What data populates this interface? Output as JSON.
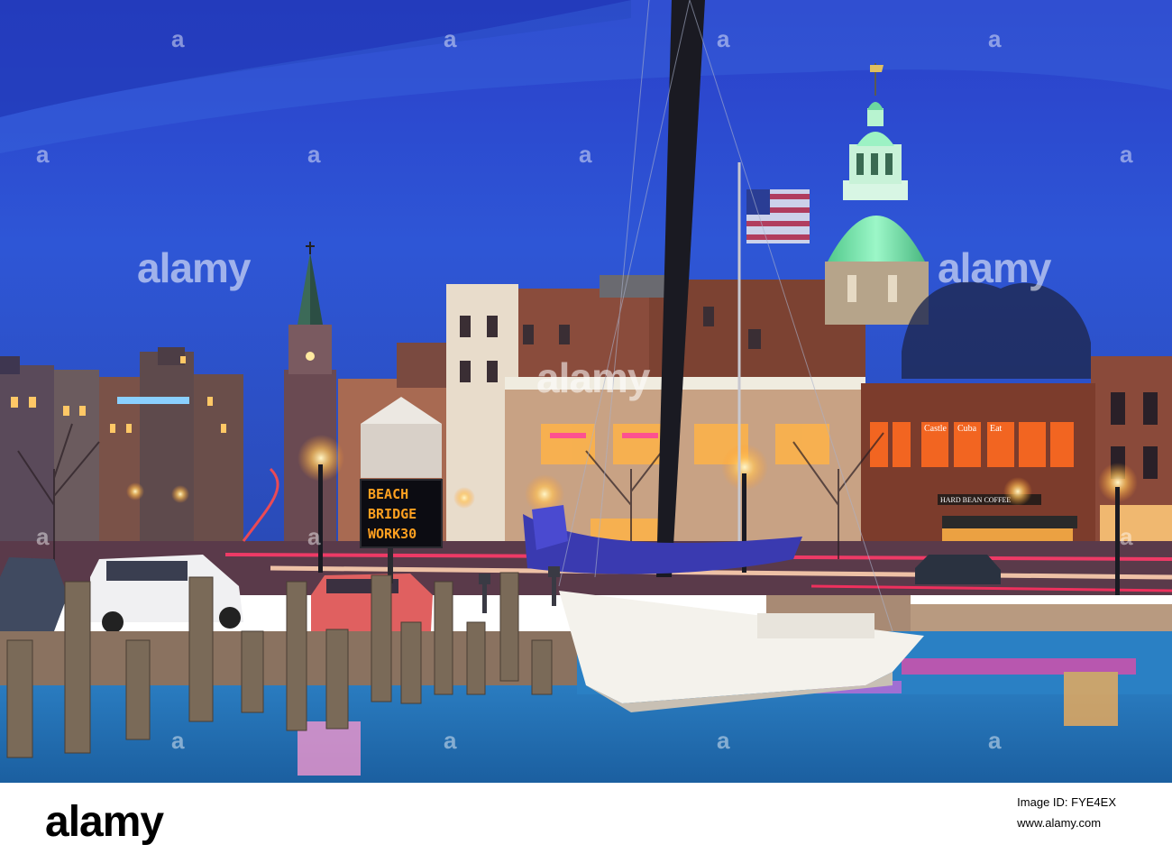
{
  "photo": {
    "sign": {
      "line1": "BEACH",
      "line2": "BRIDGE",
      "line3": "WORK30"
    },
    "storefront_labels": [
      "Castle",
      "Cuba",
      "Eat"
    ],
    "shop_sign": "HARD BEAN COFFEE"
  },
  "watermark": {
    "text": "alamy",
    "small_mark": "a"
  },
  "footer": {
    "logo": "alamy",
    "image_id": "Image ID: FYE4EX",
    "site": "www.alamy.com"
  },
  "colors": {
    "sky_top": "#1f3fc8",
    "sky_bottom": "#2c4fd4",
    "water": "#1d6fae",
    "dome_green": "#7df0b4"
  }
}
